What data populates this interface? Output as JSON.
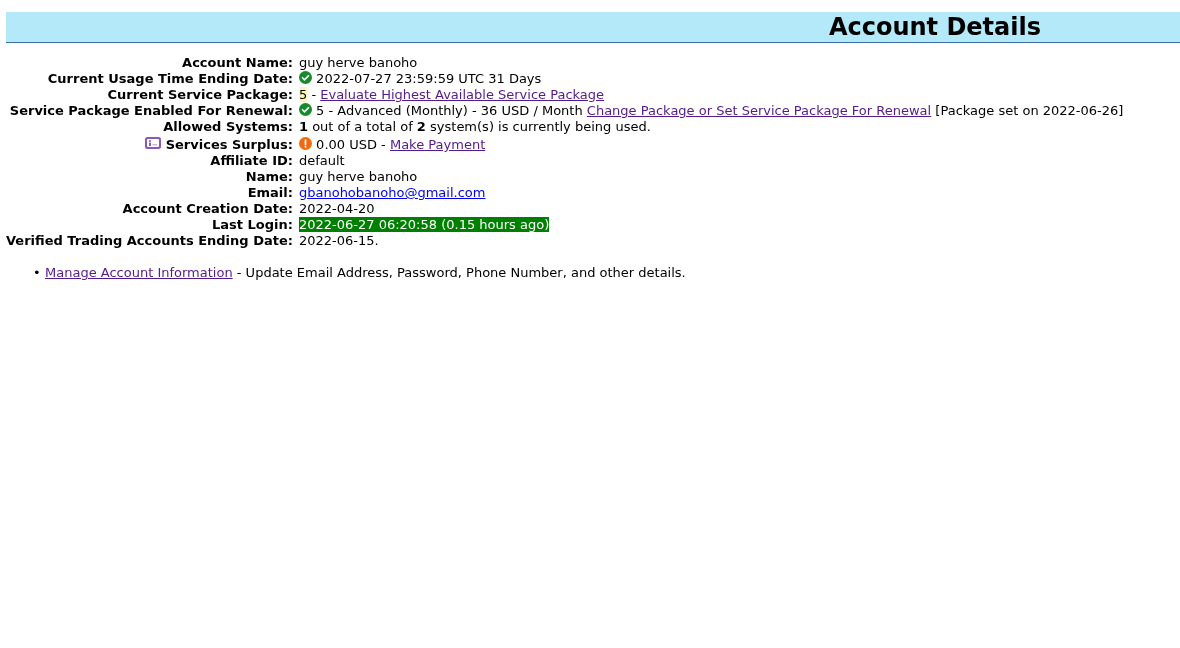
{
  "header": {
    "title": "Account Details"
  },
  "fields": [
    {
      "label": "Account Name:",
      "parts": [
        {
          "kind": "text",
          "text": "guy herve banoho"
        }
      ]
    },
    {
      "label": "Current Usage Time Ending Date:",
      "parts": [
        {
          "kind": "ok"
        },
        {
          "kind": "text",
          "text": "2022-07-27 23:59:59 UTC 31 Days"
        }
      ]
    },
    {
      "label": "Current Service Package:",
      "parts": [
        {
          "kind": "marked",
          "text": "5",
          "color": "#fff7b8"
        },
        {
          "kind": "text",
          "text": "-"
        },
        {
          "kind": "link",
          "text": "Evaluate Highest Available Service Package",
          "visited": true
        }
      ]
    },
    {
      "label": "Service Package Enabled For Renewal:",
      "parts": [
        {
          "kind": "ok"
        },
        {
          "kind": "text",
          "text": "5 - Advanced (Monthly) - 36 USD / Month"
        },
        {
          "kind": "link",
          "text": "Change Package or Set Service Package For Renewal",
          "visited": true
        },
        {
          "kind": "text",
          "text": "[Package set on 2022-06-26]"
        }
      ]
    },
    {
      "label": "Allowed Systems:",
      "parts": [
        {
          "kind": "text",
          "text": "**1** out of a total of **2** system(s) is currently being used."
        }
      ]
    },
    {
      "label": "Services Surplus:",
      "info_icon": true,
      "parts": [
        {
          "kind": "alert"
        },
        {
          "kind": "text",
          "text": "0.00 USD -"
        },
        {
          "kind": "link",
          "text": "Make Payment",
          "visited": true
        }
      ]
    },
    {
      "label": "Affiliate ID:",
      "parts": [
        {
          "kind": "text",
          "text": "default"
        }
      ]
    },
    {
      "label": "Name:",
      "parts": [
        {
          "kind": "text",
          "text": "guy herve banoho"
        }
      ]
    },
    {
      "label": "Email:",
      "parts": [
        {
          "kind": "link",
          "text": "gbanohobanoho@gmail.com",
          "visited": false
        }
      ]
    },
    {
      "label": "Account Creation Date:",
      "parts": [
        {
          "kind": "text",
          "text": "2022-04-20"
        }
      ]
    },
    {
      "label": "Last Login:",
      "parts": [
        {
          "kind": "marked",
          "text": "2022-06-27 06:20:58 (0.15 hours ago)",
          "color": "#008000"
        }
      ]
    },
    {
      "label": "Verified Trading Accounts Ending Date:",
      "parts": [
        {
          "kind": "text",
          "text": "2022-06-15."
        }
      ]
    }
  ],
  "links": [
    {
      "marker": "•",
      "link": "Manage Account Information",
      "visited": true,
      "description": "- Update Email Address, Password, Phone Number, and other details."
    }
  ]
}
